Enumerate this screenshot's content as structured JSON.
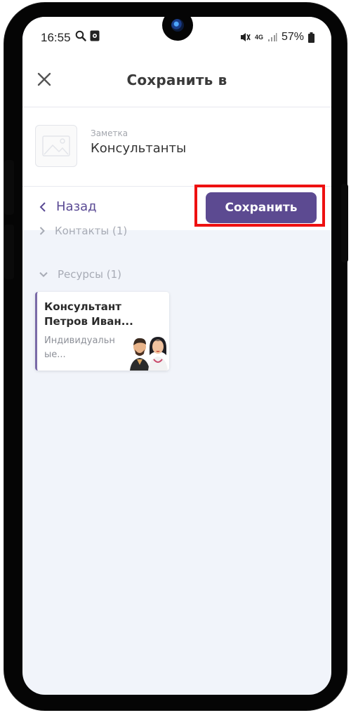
{
  "status_bar": {
    "time": "16:55",
    "network": "4G",
    "battery": "57%",
    "icons": [
      "search-icon",
      "notification-app-icon",
      "mute-icon",
      "signal-icon",
      "battery-icon"
    ]
  },
  "header": {
    "title": "Сохранить в",
    "close_icon": "close-icon"
  },
  "note": {
    "label": "Заметка",
    "title": "Консультанты",
    "thumbnail_icon": "image-placeholder-icon"
  },
  "actions": {
    "back_label": "Назад",
    "save_label": "Сохранить",
    "highlight_color": "#ee1010",
    "accent": "#5c4a91"
  },
  "sections": [
    {
      "label": "Контакты (1)",
      "expanded": false
    },
    {
      "label": "Ресурсы (1)",
      "expanded": true
    }
  ],
  "resource_card": {
    "title": "Консультант Петров Иван...",
    "subtitle": "Индивидуальн ые..."
  }
}
